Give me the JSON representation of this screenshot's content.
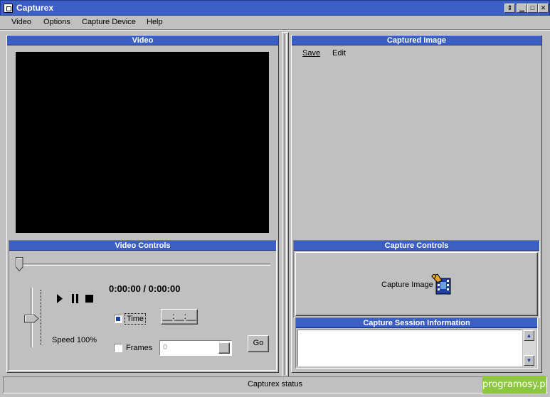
{
  "window": {
    "title": "Capturex"
  },
  "menu": {
    "video": "Video",
    "options": "Options",
    "capture_device": "Capture Device",
    "help": "Help"
  },
  "video_panel": {
    "title": "Video"
  },
  "captured_panel": {
    "title": "Captured Image",
    "save": "Save",
    "edit": "Edit"
  },
  "video_controls": {
    "title": "Video Controls",
    "time_display": "0:00:00 / 0:00:00",
    "speed": "Speed 100%",
    "time_label": "Time",
    "time_checked": true,
    "time_mask": "__:__:__",
    "frames_label": "Frames",
    "frames_checked": false,
    "frames_value": "0",
    "go": "Go",
    "position_fraction": 0.0,
    "speed_fraction": 0.55
  },
  "capture_controls": {
    "title": "Capture Controls",
    "capture_image": "Capture Image"
  },
  "session_info": {
    "title": "Capture Session Information"
  },
  "status": {
    "text": "Capturex status"
  },
  "watermark": {
    "text": "programosy.pl"
  },
  "colors": {
    "title_bar": "#3c5fc5",
    "panel_header": "#3c5fc5",
    "face": "#c0c0c0",
    "watermark": "#8dc63f"
  },
  "icons": [
    "app-icon",
    "play-icon",
    "pause-icon",
    "stop-icon",
    "capture-camera-icon",
    "scroll-up-icon",
    "scroll-down-icon"
  ]
}
